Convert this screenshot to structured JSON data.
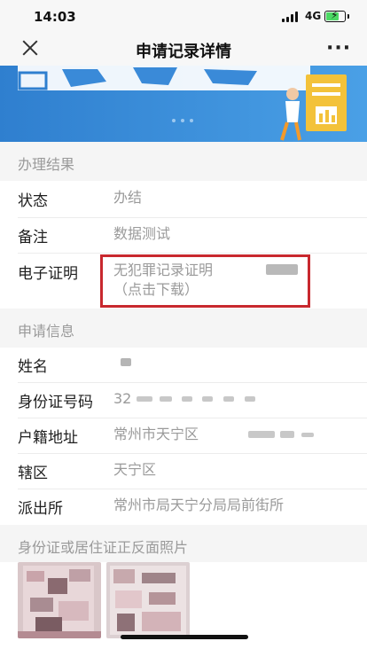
{
  "status_bar": {
    "time": "14:03",
    "network": "4G"
  },
  "nav": {
    "title": "申请记录详情"
  },
  "sections": {
    "result": {
      "header": "办理结果",
      "status_label": "状态",
      "status_value": "办结",
      "remark_label": "备注",
      "remark_value": "数据测试",
      "cert_label": "电子证明",
      "cert_value_line1": "无犯罪记录证明",
      "cert_value_line2": "（点击下载）"
    },
    "application": {
      "header": "申请信息",
      "name_label": "姓名",
      "id_label": "身份证号码",
      "id_value_prefix": "32",
      "hukou_label": "户籍地址",
      "hukou_value": "常州市天宁区",
      "district_label": "辖区",
      "district_value": "天宁区",
      "station_label": "派出所",
      "station_value": "常州市局天宁分局局前街所"
    },
    "photos": {
      "header": "身份证或居住证正反面照片"
    }
  },
  "colors": {
    "accent_red": "#c8282e",
    "banner_blue": "#3b8fd6",
    "muted_text": "#9a9a9a"
  }
}
